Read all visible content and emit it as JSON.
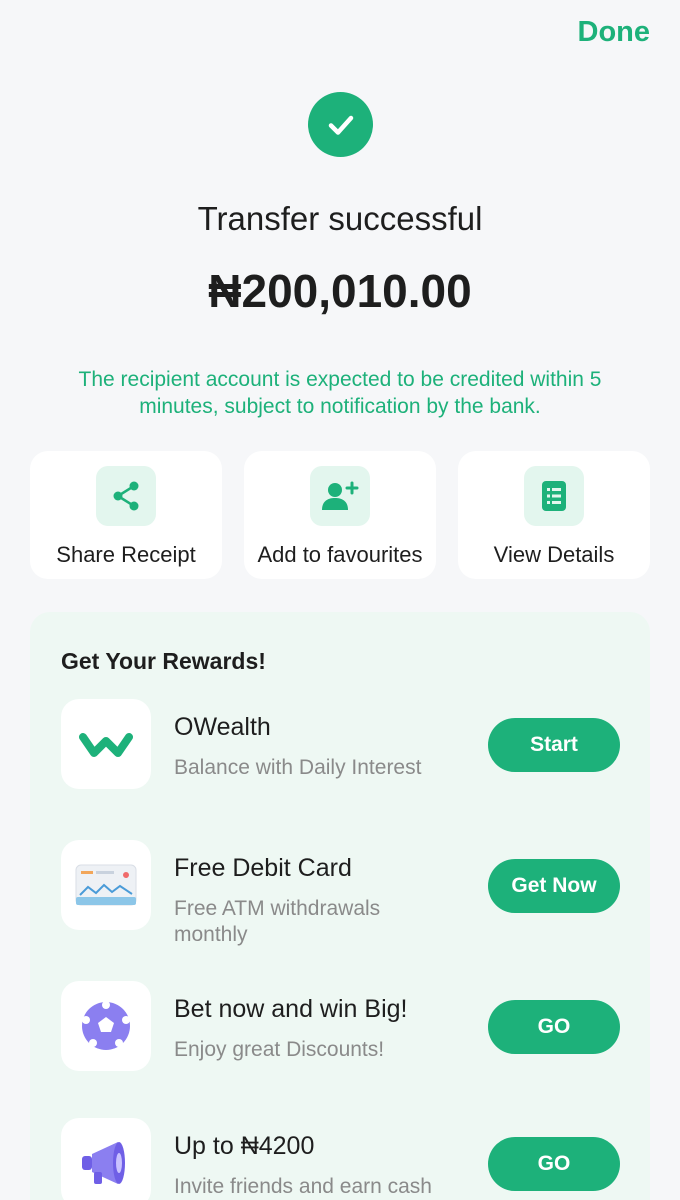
{
  "header": {
    "done_label": "Done"
  },
  "status": {
    "icon": "check-icon",
    "title": "Transfer successful",
    "amount": "₦200,010.00",
    "note": "The recipient account is expected to be credited within 5 minutes, subject to notification by the bank."
  },
  "actions": [
    {
      "label": "Share Receipt",
      "icon": "share-icon"
    },
    {
      "label": "Add to favourites",
      "icon": "add-user-icon"
    },
    {
      "label": "View Details",
      "icon": "document-list-icon"
    }
  ],
  "rewards": {
    "title": "Get Your Rewards!",
    "items": [
      {
        "name": "OWealth",
        "description": "Balance with Daily Interest",
        "button": "Start",
        "icon": "owealth-logo-icon"
      },
      {
        "name": "Free Debit Card",
        "description": "Free ATM withdrawals monthly",
        "button": "Get Now",
        "icon": "debit-card-icon"
      },
      {
        "name": "Bet now and win Big!",
        "description": "Enjoy great Discounts!",
        "button": "GO",
        "icon": "soccer-ball-icon"
      },
      {
        "name": "Up to ₦4200",
        "description": "Invite friends and earn cash",
        "button": "GO",
        "icon": "megaphone-icon"
      }
    ]
  },
  "colors": {
    "accent": "#1db17a",
    "accent_light": "#e3f6ee",
    "rewards_bg": "#eef8f3",
    "background": "#f6f7f9"
  }
}
